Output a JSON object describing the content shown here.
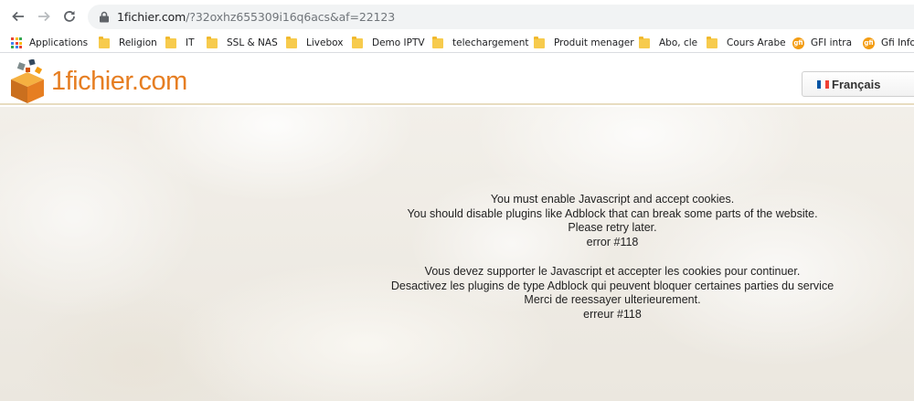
{
  "browser": {
    "url_host": "1fichier.com",
    "url_rest": "/?32oxhz655309i16q6acs&af=22123",
    "bookmarks": [
      {
        "label": "Applications",
        "icon": "apps-grid-icon"
      },
      {
        "label": "Religion",
        "icon": "folder-icon"
      },
      {
        "label": "IT",
        "icon": "folder-icon"
      },
      {
        "label": "SSL & NAS",
        "icon": "folder-icon"
      },
      {
        "label": "Livebox",
        "icon": "folder-icon"
      },
      {
        "label": "Demo IPTV",
        "icon": "folder-icon"
      },
      {
        "label": "telechargement",
        "icon": "folder-icon"
      },
      {
        "label": "Produit menager",
        "icon": "folder-icon"
      },
      {
        "label": "Abo, cle",
        "icon": "folder-icon"
      },
      {
        "label": "Cours Arabe",
        "icon": "folder-icon"
      },
      {
        "label": "GFI intra",
        "icon": "gfi-icon"
      },
      {
        "label": "Gfi Info",
        "icon": "gfi-icon"
      }
    ],
    "gfi_icon_text": "gfi"
  },
  "site": {
    "logo_text": "1fichier.com",
    "language_label": "Français",
    "brand_color": "#e67e22"
  },
  "message_en": [
    "You must enable Javascript and accept cookies.",
    "You should disable plugins like Adblock that can break some parts of the website.",
    "Please retry later.",
    "error #118"
  ],
  "message_fr": [
    "Vous devez supporter le Javascript et accepter les cookies pour continuer.",
    "Desactivez les plugins de type Adblock qui peuvent bloquer certaines parties du service",
    "Merci de reessayer ulterieurement.",
    "erreur #118"
  ]
}
